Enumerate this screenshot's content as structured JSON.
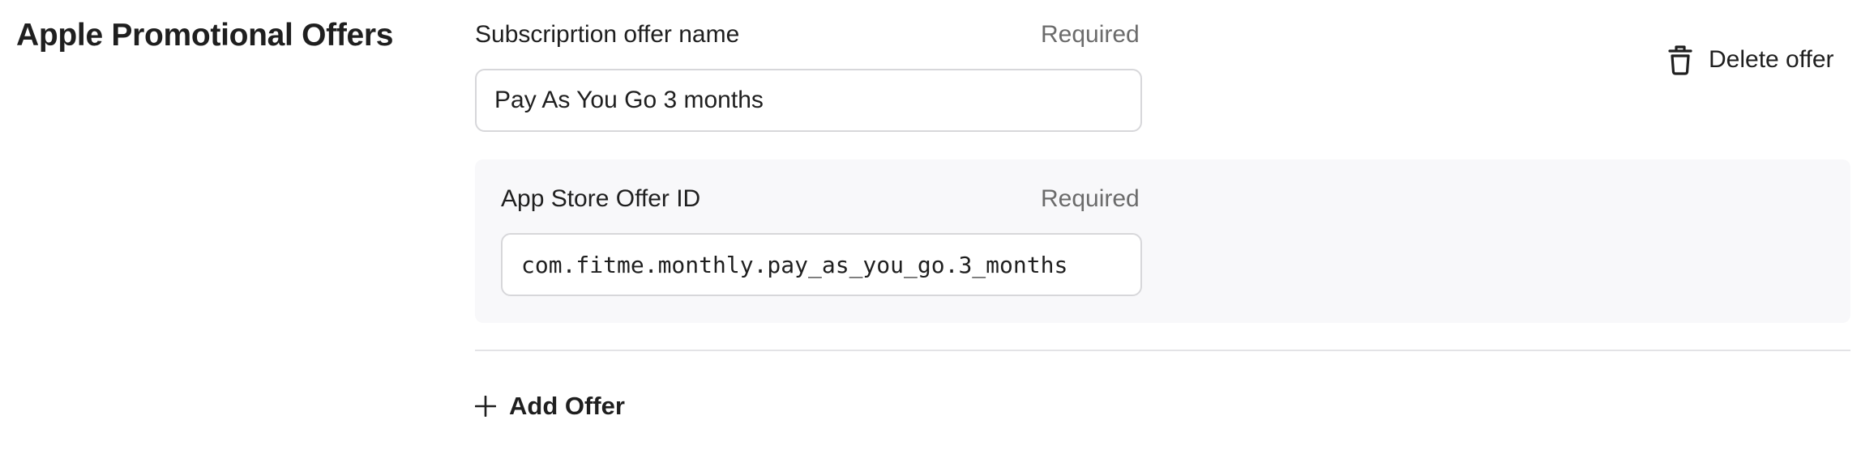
{
  "section": {
    "title": "Apple Promotional Offers"
  },
  "offer": {
    "name_label": "Subscriprtion offer name",
    "name_required": "Required",
    "name_value": "Pay As You Go 3 months",
    "offer_id_label": "App Store Offer ID",
    "offer_id_required": "Required",
    "offer_id_value": "com.fitme.monthly.pay_as_you_go.3_months",
    "delete_label": "Delete offer",
    "delete_icon": "trash-icon"
  },
  "actions": {
    "add_offer_label": "Add Offer",
    "add_icon": "plus-icon"
  }
}
